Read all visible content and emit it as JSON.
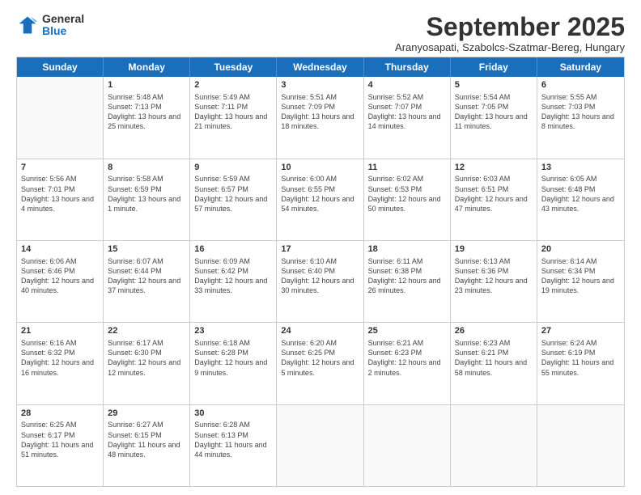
{
  "logo": {
    "general": "General",
    "blue": "Blue"
  },
  "title": "September 2025",
  "subtitle": "Aranyosapati, Szabolcs-Szatmar-Bereg, Hungary",
  "header_days": [
    "Sunday",
    "Monday",
    "Tuesday",
    "Wednesday",
    "Thursday",
    "Friday",
    "Saturday"
  ],
  "rows": [
    [
      {
        "day": "",
        "sunrise": "",
        "sunset": "",
        "daylight": ""
      },
      {
        "day": "1",
        "sunrise": "Sunrise: 5:48 AM",
        "sunset": "Sunset: 7:13 PM",
        "daylight": "Daylight: 13 hours and 25 minutes."
      },
      {
        "day": "2",
        "sunrise": "Sunrise: 5:49 AM",
        "sunset": "Sunset: 7:11 PM",
        "daylight": "Daylight: 13 hours and 21 minutes."
      },
      {
        "day": "3",
        "sunrise": "Sunrise: 5:51 AM",
        "sunset": "Sunset: 7:09 PM",
        "daylight": "Daylight: 13 hours and 18 minutes."
      },
      {
        "day": "4",
        "sunrise": "Sunrise: 5:52 AM",
        "sunset": "Sunset: 7:07 PM",
        "daylight": "Daylight: 13 hours and 14 minutes."
      },
      {
        "day": "5",
        "sunrise": "Sunrise: 5:54 AM",
        "sunset": "Sunset: 7:05 PM",
        "daylight": "Daylight: 13 hours and 11 minutes."
      },
      {
        "day": "6",
        "sunrise": "Sunrise: 5:55 AM",
        "sunset": "Sunset: 7:03 PM",
        "daylight": "Daylight: 13 hours and 8 minutes."
      }
    ],
    [
      {
        "day": "7",
        "sunrise": "Sunrise: 5:56 AM",
        "sunset": "Sunset: 7:01 PM",
        "daylight": "Daylight: 13 hours and 4 minutes."
      },
      {
        "day": "8",
        "sunrise": "Sunrise: 5:58 AM",
        "sunset": "Sunset: 6:59 PM",
        "daylight": "Daylight: 13 hours and 1 minute."
      },
      {
        "day": "9",
        "sunrise": "Sunrise: 5:59 AM",
        "sunset": "Sunset: 6:57 PM",
        "daylight": "Daylight: 12 hours and 57 minutes."
      },
      {
        "day": "10",
        "sunrise": "Sunrise: 6:00 AM",
        "sunset": "Sunset: 6:55 PM",
        "daylight": "Daylight: 12 hours and 54 minutes."
      },
      {
        "day": "11",
        "sunrise": "Sunrise: 6:02 AM",
        "sunset": "Sunset: 6:53 PM",
        "daylight": "Daylight: 12 hours and 50 minutes."
      },
      {
        "day": "12",
        "sunrise": "Sunrise: 6:03 AM",
        "sunset": "Sunset: 6:51 PM",
        "daylight": "Daylight: 12 hours and 47 minutes."
      },
      {
        "day": "13",
        "sunrise": "Sunrise: 6:05 AM",
        "sunset": "Sunset: 6:48 PM",
        "daylight": "Daylight: 12 hours and 43 minutes."
      }
    ],
    [
      {
        "day": "14",
        "sunrise": "Sunrise: 6:06 AM",
        "sunset": "Sunset: 6:46 PM",
        "daylight": "Daylight: 12 hours and 40 minutes."
      },
      {
        "day": "15",
        "sunrise": "Sunrise: 6:07 AM",
        "sunset": "Sunset: 6:44 PM",
        "daylight": "Daylight: 12 hours and 37 minutes."
      },
      {
        "day": "16",
        "sunrise": "Sunrise: 6:09 AM",
        "sunset": "Sunset: 6:42 PM",
        "daylight": "Daylight: 12 hours and 33 minutes."
      },
      {
        "day": "17",
        "sunrise": "Sunrise: 6:10 AM",
        "sunset": "Sunset: 6:40 PM",
        "daylight": "Daylight: 12 hours and 30 minutes."
      },
      {
        "day": "18",
        "sunrise": "Sunrise: 6:11 AM",
        "sunset": "Sunset: 6:38 PM",
        "daylight": "Daylight: 12 hours and 26 minutes."
      },
      {
        "day": "19",
        "sunrise": "Sunrise: 6:13 AM",
        "sunset": "Sunset: 6:36 PM",
        "daylight": "Daylight: 12 hours and 23 minutes."
      },
      {
        "day": "20",
        "sunrise": "Sunrise: 6:14 AM",
        "sunset": "Sunset: 6:34 PM",
        "daylight": "Daylight: 12 hours and 19 minutes."
      }
    ],
    [
      {
        "day": "21",
        "sunrise": "Sunrise: 6:16 AM",
        "sunset": "Sunset: 6:32 PM",
        "daylight": "Daylight: 12 hours and 16 minutes."
      },
      {
        "day": "22",
        "sunrise": "Sunrise: 6:17 AM",
        "sunset": "Sunset: 6:30 PM",
        "daylight": "Daylight: 12 hours and 12 minutes."
      },
      {
        "day": "23",
        "sunrise": "Sunrise: 6:18 AM",
        "sunset": "Sunset: 6:28 PM",
        "daylight": "Daylight: 12 hours and 9 minutes."
      },
      {
        "day": "24",
        "sunrise": "Sunrise: 6:20 AM",
        "sunset": "Sunset: 6:25 PM",
        "daylight": "Daylight: 12 hours and 5 minutes."
      },
      {
        "day": "25",
        "sunrise": "Sunrise: 6:21 AM",
        "sunset": "Sunset: 6:23 PM",
        "daylight": "Daylight: 12 hours and 2 minutes."
      },
      {
        "day": "26",
        "sunrise": "Sunrise: 6:23 AM",
        "sunset": "Sunset: 6:21 PM",
        "daylight": "Daylight: 11 hours and 58 minutes."
      },
      {
        "day": "27",
        "sunrise": "Sunrise: 6:24 AM",
        "sunset": "Sunset: 6:19 PM",
        "daylight": "Daylight: 11 hours and 55 minutes."
      }
    ],
    [
      {
        "day": "28",
        "sunrise": "Sunrise: 6:25 AM",
        "sunset": "Sunset: 6:17 PM",
        "daylight": "Daylight: 11 hours and 51 minutes."
      },
      {
        "day": "29",
        "sunrise": "Sunrise: 6:27 AM",
        "sunset": "Sunset: 6:15 PM",
        "daylight": "Daylight: 11 hours and 48 minutes."
      },
      {
        "day": "30",
        "sunrise": "Sunrise: 6:28 AM",
        "sunset": "Sunset: 6:13 PM",
        "daylight": "Daylight: 11 hours and 44 minutes."
      },
      {
        "day": "",
        "sunrise": "",
        "sunset": "",
        "daylight": ""
      },
      {
        "day": "",
        "sunrise": "",
        "sunset": "",
        "daylight": ""
      },
      {
        "day": "",
        "sunrise": "",
        "sunset": "",
        "daylight": ""
      },
      {
        "day": "",
        "sunrise": "",
        "sunset": "",
        "daylight": ""
      }
    ]
  ]
}
